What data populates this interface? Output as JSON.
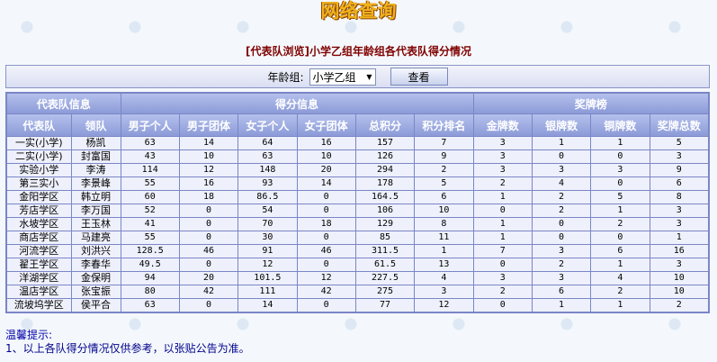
{
  "header": {
    "logo": "网络查询",
    "title": "[代表队浏览]小学乙组年龄组各代表队得分情况"
  },
  "filter": {
    "age_label": "年龄组:",
    "age_value": "小学乙组",
    "view_button": "查看"
  },
  "table": {
    "group_headers": [
      "代表队信息",
      "得分信息",
      "奖牌榜"
    ],
    "columns": [
      "代表队",
      "领队",
      "男子个人",
      "男子团体",
      "女子个人",
      "女子团体",
      "总积分",
      "积分排名",
      "金牌数",
      "银牌数",
      "铜牌数",
      "奖牌总数"
    ],
    "rows": [
      [
        "一实(小学)",
        "杨凯",
        "63",
        "14",
        "64",
        "16",
        "157",
        "7",
        "3",
        "1",
        "1",
        "5"
      ],
      [
        "二实(小学)",
        "封富国",
        "43",
        "10",
        "63",
        "10",
        "126",
        "9",
        "3",
        "0",
        "0",
        "3"
      ],
      [
        "实验小学",
        "李涛",
        "114",
        "12",
        "148",
        "20",
        "294",
        "2",
        "3",
        "3",
        "3",
        "9"
      ],
      [
        "第三实小",
        "李景峰",
        "55",
        "16",
        "93",
        "14",
        "178",
        "5",
        "2",
        "4",
        "0",
        "6"
      ],
      [
        "金阳学区",
        "韩立明",
        "60",
        "18",
        "86.5",
        "0",
        "164.5",
        "6",
        "1",
        "2",
        "5",
        "8"
      ],
      [
        "芳店学区",
        "李万国",
        "52",
        "0",
        "54",
        "0",
        "106",
        "10",
        "0",
        "2",
        "1",
        "3"
      ],
      [
        "水坡学区",
        "王玉林",
        "41",
        "0",
        "70",
        "18",
        "129",
        "8",
        "1",
        "0",
        "2",
        "3"
      ],
      [
        "商店学区",
        "马建亮",
        "55",
        "0",
        "30",
        "0",
        "85",
        "11",
        "1",
        "0",
        "0",
        "1"
      ],
      [
        "河流学区",
        "刘洪兴",
        "128.5",
        "46",
        "91",
        "46",
        "311.5",
        "1",
        "7",
        "3",
        "6",
        "16"
      ],
      [
        "翟王学区",
        "李春华",
        "49.5",
        "0",
        "12",
        "0",
        "61.5",
        "13",
        "0",
        "2",
        "1",
        "3"
      ],
      [
        "洋湖学区",
        "金保明",
        "94",
        "20",
        "101.5",
        "12",
        "227.5",
        "4",
        "3",
        "3",
        "4",
        "10"
      ],
      [
        "温店学区",
        "张宝振",
        "80",
        "42",
        "111",
        "42",
        "275",
        "3",
        "2",
        "6",
        "2",
        "10"
      ],
      [
        "流坡坞学区",
        "侯平合",
        "63",
        "0",
        "14",
        "0",
        "77",
        "12",
        "0",
        "1",
        "1",
        "2"
      ]
    ]
  },
  "notice": {
    "title": "温馨提示:",
    "lines": [
      "1、以上各队得分情况仅供参考，以张贴公告为准。"
    ]
  }
}
